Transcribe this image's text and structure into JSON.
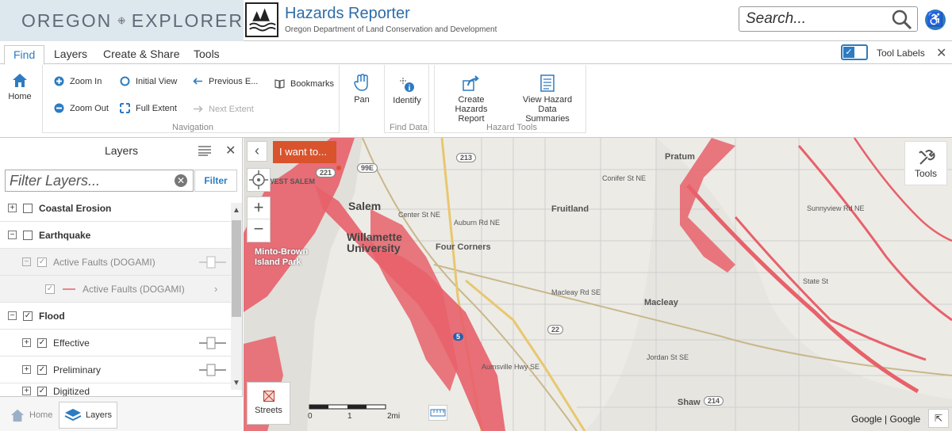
{
  "header": {
    "logo_left": "OREGON",
    "logo_right": "EXPLORER",
    "app_title": "Hazards Reporter",
    "app_subtitle": "Oregon Department of Land Conservation and Development",
    "search_placeholder": "Search..."
  },
  "tabs": [
    {
      "label": "Find",
      "active": true
    },
    {
      "label": "Layers",
      "active": false
    },
    {
      "label": "Create & Share",
      "active": false
    },
    {
      "label": "Tools",
      "active": false
    }
  ],
  "tool_labels": {
    "label": "Tool Labels",
    "checked": true
  },
  "ribbon": {
    "home": "Home",
    "zoom_in": "Zoom In",
    "zoom_out": "Zoom Out",
    "initial_view": "Initial View",
    "full_extent": "Full Extent",
    "previous_extent": "Previous E...",
    "next_extent": "Next Extent",
    "bookmarks": "Bookmarks",
    "navigation_group": "Navigation",
    "pan": "Pan",
    "identify": "Identify",
    "find_data_group": "Find Data",
    "create_report_1": "Create Hazards",
    "create_report_2": "Report",
    "view_summaries_1": "View Hazard",
    "view_summaries_2": "Data Summaries",
    "hazard_tools_group": "Hazard Tools"
  },
  "layers_panel": {
    "title": "Layers",
    "filter_placeholder": "Filter Layers...",
    "filter_button": "Filter",
    "rows": [
      {
        "name": "Coastal Erosion",
        "checked": false,
        "expand": "+"
      },
      {
        "name": "Earthquake",
        "checked": false,
        "expand": "−"
      },
      {
        "name": "Active Faults (DOGAMI)",
        "checked": true,
        "expand": "−"
      },
      {
        "name": "Active Faults (DOGAMI)",
        "checked": true
      },
      {
        "name": "Flood",
        "checked": true,
        "expand": "−"
      },
      {
        "name": "Effective",
        "checked": true,
        "expand": "+"
      },
      {
        "name": "Preliminary",
        "checked": true,
        "expand": "+"
      },
      {
        "name": "Digitized",
        "checked": true,
        "expand": "+"
      }
    ]
  },
  "footer": {
    "home": "Home",
    "layers": "Layers"
  },
  "map": {
    "i_want_to": "I want to...",
    "tools": "Tools",
    "streets": "Streets",
    "scale_0": "0",
    "scale_1": "1",
    "scale_2": "2mi",
    "attribution": "Google | Google",
    "labels": {
      "salem": "Salem",
      "willamette_university_1": "Willamette",
      "willamette_university_2": "University",
      "four_corners": "Four Corners",
      "fruitland": "Fruitland",
      "macleay": "Macleay",
      "pratum": "Pratum",
      "shaw": "Shaw",
      "minto_brown_1": "Minto-Brown",
      "minto_brown_2": "Island Park",
      "west_salem": "WEST SALEM",
      "center_st": "Center St NE",
      "auburn_rd": "Auburn Rd NE",
      "state_st": "State St",
      "sunnyview_rd": "Sunnyview Rd NE",
      "conifer_st": "Conifer St NE",
      "macleay_rd": "Macleay Rd SE",
      "jordan_st": "Jordan St SE",
      "aumsville_hwy": "Aumsville Hwy SE",
      "hwy_22": "22",
      "hwy_213": "213",
      "hwy_214": "214",
      "hwy_221": "221",
      "hwy_99e": "99E",
      "i5": "5"
    }
  },
  "colors": {
    "accent": "#2d7bc1",
    "flood": "#e8616a",
    "i_want_bg": "#d9532c"
  }
}
